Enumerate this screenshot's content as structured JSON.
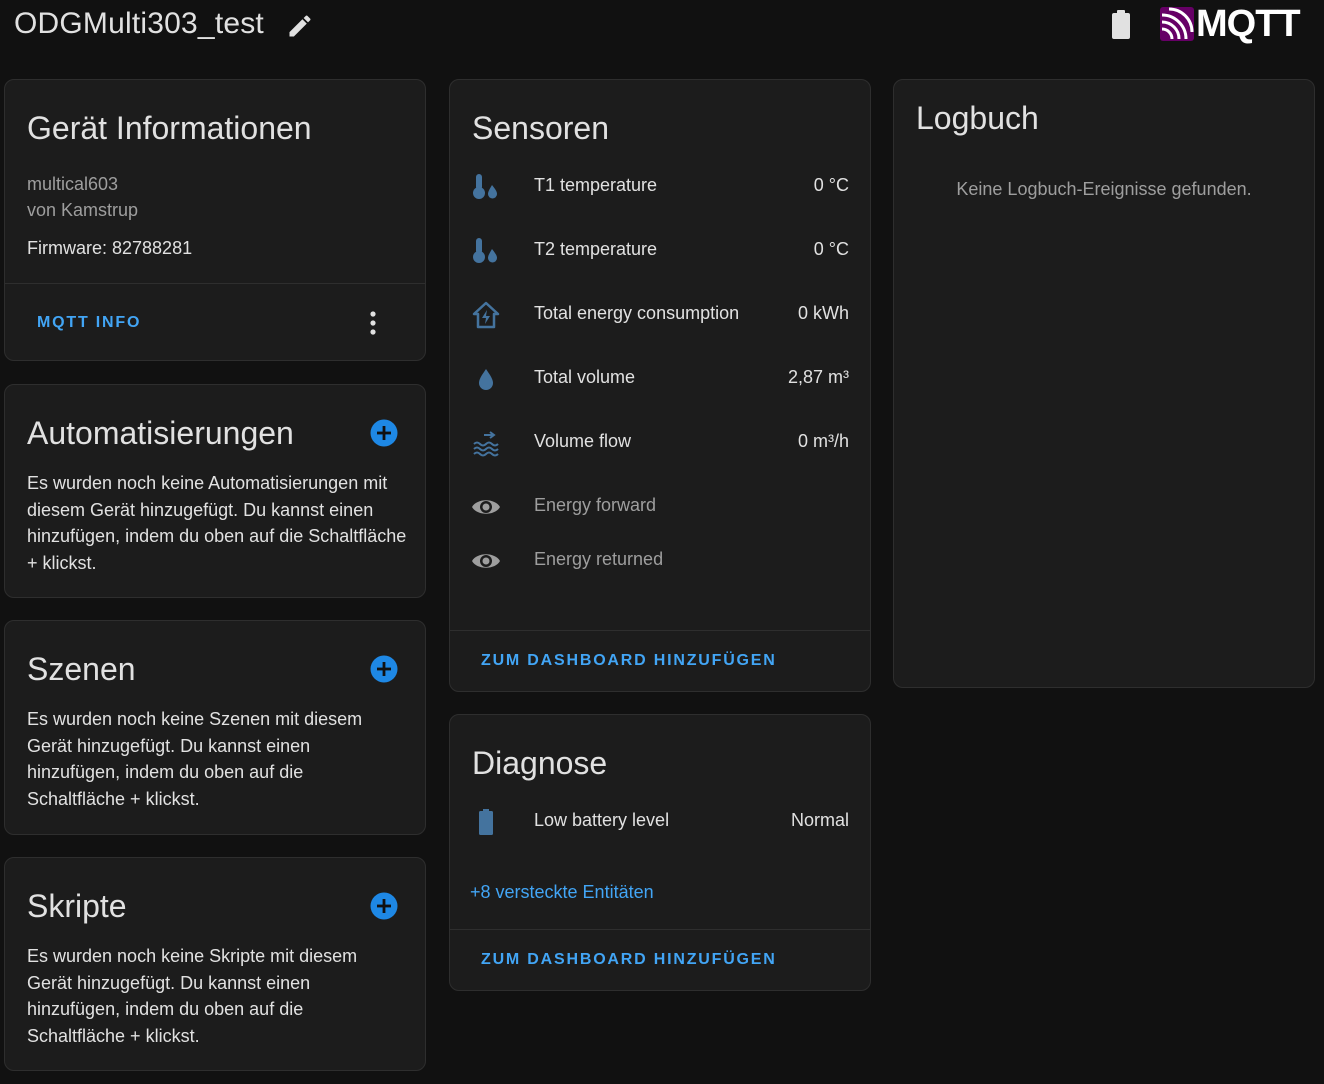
{
  "header": {
    "title": "ODGMulti303_test",
    "brand": "MQTT"
  },
  "device_info": {
    "title": "Gerät Informationen",
    "model": "multical603",
    "manufacturer": "von Kamstrup",
    "firmware": "Firmware: 82788281",
    "mqtt_info_label": "MQTT INFO"
  },
  "automations": {
    "title": "Automatisierungen",
    "empty_text": "Es wurden noch keine Automatisierungen mit diesem Gerät hinzugefügt. Du kannst einen hinzufügen, indem du oben auf die Schaltfläche + klickst."
  },
  "scenes": {
    "title": "Szenen",
    "empty_text": "Es wurden noch keine Szenen mit diesem Gerät hinzugefügt. Du kannst einen hinzufügen, indem du oben auf die Schaltfläche + klickst."
  },
  "scripts": {
    "title": "Skripte",
    "empty_text": "Es wurden noch keine Skripte mit diesem Gerät hinzugefügt. Du kannst einen hinzufügen, indem du oben auf die Schaltfläche + klickst."
  },
  "sensors": {
    "title": "Sensoren",
    "items": [
      {
        "name": "T1 temperature",
        "value": "0 °C",
        "icon": "thermometer-water-icon"
      },
      {
        "name": "T2 temperature",
        "value": "0 °C",
        "icon": "thermometer-water-icon"
      },
      {
        "name": "Total energy consumption",
        "value": "0 kWh",
        "icon": "home-lightning-icon"
      },
      {
        "name": "Total volume",
        "value": "2,87 m³",
        "icon": "water-drop-icon"
      },
      {
        "name": "Volume flow",
        "value": "0 m³/h",
        "icon": "water-flow-icon"
      },
      {
        "name": "Energy forward",
        "value": "",
        "icon": "eye-icon"
      },
      {
        "name": "Energy returned",
        "value": "",
        "icon": "eye-icon"
      }
    ],
    "add_to_dashboard": "ZUM DASHBOARD HINZUFÜGEN"
  },
  "diagnostics": {
    "title": "Diagnose",
    "items": [
      {
        "name": "Low battery level",
        "value": "Normal",
        "icon": "battery-icon"
      }
    ],
    "hidden_entities": "+8 versteckte Entitäten",
    "add_to_dashboard": "ZUM DASHBOARD HINZUFÜGEN"
  },
  "logbook": {
    "title": "Logbuch",
    "empty_text": "Keine Logbuch-Ereignisse gefunden."
  },
  "colors": {
    "background": "#111111",
    "card": "#1c1c1c",
    "accent": "#42a5f5",
    "icon": "#44739e",
    "mqtt_purple": "#660066"
  }
}
